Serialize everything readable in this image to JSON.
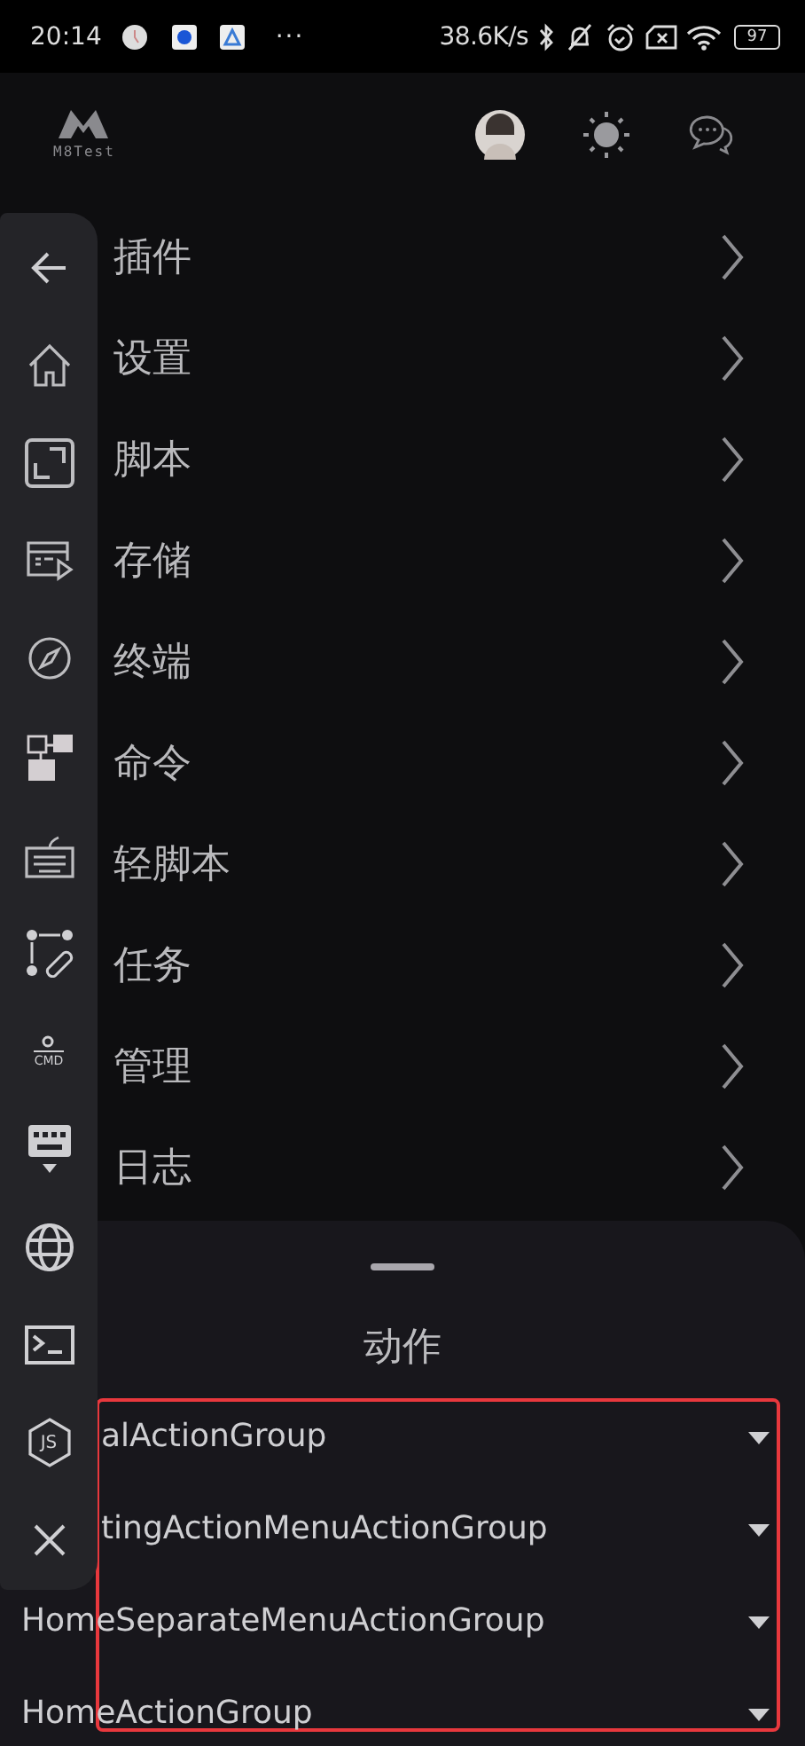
{
  "status_bar": {
    "time": "20:14",
    "more": "···",
    "speed": "38.6K/s",
    "battery": "97"
  },
  "header": {
    "logo_text": "M8Test"
  },
  "menu": [
    {
      "label": "插件"
    },
    {
      "label": "设置"
    },
    {
      "label": "脚本"
    },
    {
      "label": "存储"
    },
    {
      "label": "终端"
    },
    {
      "label": "命令"
    },
    {
      "label": "轻脚本"
    },
    {
      "label": "任务"
    },
    {
      "label": "管理"
    },
    {
      "label": "日志"
    }
  ],
  "side_rail": [
    {
      "kind": "back"
    },
    {
      "kind": "home"
    },
    {
      "kind": "fullscreen"
    },
    {
      "kind": "screen-play"
    },
    {
      "kind": "compass"
    },
    {
      "kind": "blocks"
    },
    {
      "kind": "keyboard"
    },
    {
      "kind": "link"
    },
    {
      "kind": "cmd",
      "text": "CMD"
    },
    {
      "kind": "keyboard-down"
    },
    {
      "kind": "globe"
    },
    {
      "kind": "terminal"
    },
    {
      "kind": "nodejs",
      "text": "JS"
    },
    {
      "kind": "close"
    }
  ],
  "sheet": {
    "title": "动作",
    "dropdowns": [
      {
        "value": "alActionGroup",
        "partly_hidden": true
      },
      {
        "value": "tingActionMenuActionGroup",
        "partly_hidden": true
      },
      {
        "value": "HomeSeparateMenuActionGroup",
        "partly_hidden": false
      },
      {
        "value": "HomeActionGroup",
        "partly_hidden": false
      }
    ]
  }
}
